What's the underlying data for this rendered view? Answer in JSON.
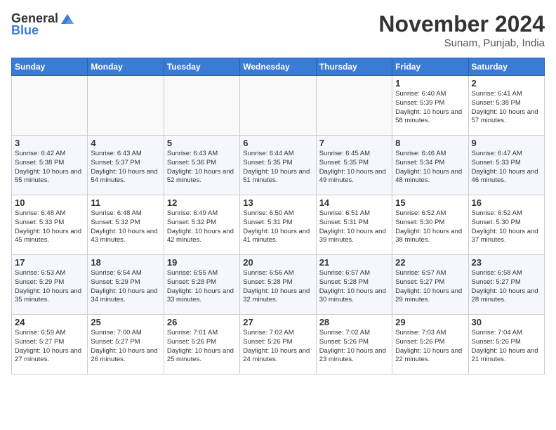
{
  "header": {
    "logo_general": "General",
    "logo_blue": "Blue",
    "month_title": "November 2024",
    "location": "Sunam, Punjab, India"
  },
  "weekdays": [
    "Sunday",
    "Monday",
    "Tuesday",
    "Wednesday",
    "Thursday",
    "Friday",
    "Saturday"
  ],
  "weeks": [
    [
      {
        "day": "",
        "empty": true
      },
      {
        "day": "",
        "empty": true
      },
      {
        "day": "",
        "empty": true
      },
      {
        "day": "",
        "empty": true
      },
      {
        "day": "",
        "empty": true
      },
      {
        "day": "1",
        "sunrise": "Sunrise: 6:40 AM",
        "sunset": "Sunset: 5:39 PM",
        "daylight": "Daylight: 10 hours and 58 minutes."
      },
      {
        "day": "2",
        "sunrise": "Sunrise: 6:41 AM",
        "sunset": "Sunset: 5:38 PM",
        "daylight": "Daylight: 10 hours and 57 minutes."
      }
    ],
    [
      {
        "day": "3",
        "sunrise": "Sunrise: 6:42 AM",
        "sunset": "Sunset: 5:38 PM",
        "daylight": "Daylight: 10 hours and 55 minutes."
      },
      {
        "day": "4",
        "sunrise": "Sunrise: 6:43 AM",
        "sunset": "Sunset: 5:37 PM",
        "daylight": "Daylight: 10 hours and 54 minutes."
      },
      {
        "day": "5",
        "sunrise": "Sunrise: 6:43 AM",
        "sunset": "Sunset: 5:36 PM",
        "daylight": "Daylight: 10 hours and 52 minutes."
      },
      {
        "day": "6",
        "sunrise": "Sunrise: 6:44 AM",
        "sunset": "Sunset: 5:35 PM",
        "daylight": "Daylight: 10 hours and 51 minutes."
      },
      {
        "day": "7",
        "sunrise": "Sunrise: 6:45 AM",
        "sunset": "Sunset: 5:35 PM",
        "daylight": "Daylight: 10 hours and 49 minutes."
      },
      {
        "day": "8",
        "sunrise": "Sunrise: 6:46 AM",
        "sunset": "Sunset: 5:34 PM",
        "daylight": "Daylight: 10 hours and 48 minutes."
      },
      {
        "day": "9",
        "sunrise": "Sunrise: 6:47 AM",
        "sunset": "Sunset: 5:33 PM",
        "daylight": "Daylight: 10 hours and 46 minutes."
      }
    ],
    [
      {
        "day": "10",
        "sunrise": "Sunrise: 6:48 AM",
        "sunset": "Sunset: 5:33 PM",
        "daylight": "Daylight: 10 hours and 45 minutes."
      },
      {
        "day": "11",
        "sunrise": "Sunrise: 6:48 AM",
        "sunset": "Sunset: 5:32 PM",
        "daylight": "Daylight: 10 hours and 43 minutes."
      },
      {
        "day": "12",
        "sunrise": "Sunrise: 6:49 AM",
        "sunset": "Sunset: 5:32 PM",
        "daylight": "Daylight: 10 hours and 42 minutes."
      },
      {
        "day": "13",
        "sunrise": "Sunrise: 6:50 AM",
        "sunset": "Sunset: 5:31 PM",
        "daylight": "Daylight: 10 hours and 41 minutes."
      },
      {
        "day": "14",
        "sunrise": "Sunrise: 6:51 AM",
        "sunset": "Sunset: 5:31 PM",
        "daylight": "Daylight: 10 hours and 39 minutes."
      },
      {
        "day": "15",
        "sunrise": "Sunrise: 6:52 AM",
        "sunset": "Sunset: 5:30 PM",
        "daylight": "Daylight: 10 hours and 38 minutes."
      },
      {
        "day": "16",
        "sunrise": "Sunrise: 6:52 AM",
        "sunset": "Sunset: 5:30 PM",
        "daylight": "Daylight: 10 hours and 37 minutes."
      }
    ],
    [
      {
        "day": "17",
        "sunrise": "Sunrise: 6:53 AM",
        "sunset": "Sunset: 5:29 PM",
        "daylight": "Daylight: 10 hours and 35 minutes."
      },
      {
        "day": "18",
        "sunrise": "Sunrise: 6:54 AM",
        "sunset": "Sunset: 5:29 PM",
        "daylight": "Daylight: 10 hours and 34 minutes."
      },
      {
        "day": "19",
        "sunrise": "Sunrise: 6:55 AM",
        "sunset": "Sunset: 5:28 PM",
        "daylight": "Daylight: 10 hours and 33 minutes."
      },
      {
        "day": "20",
        "sunrise": "Sunrise: 6:56 AM",
        "sunset": "Sunset: 5:28 PM",
        "daylight": "Daylight: 10 hours and 32 minutes."
      },
      {
        "day": "21",
        "sunrise": "Sunrise: 6:57 AM",
        "sunset": "Sunset: 5:28 PM",
        "daylight": "Daylight: 10 hours and 30 minutes."
      },
      {
        "day": "22",
        "sunrise": "Sunrise: 6:57 AM",
        "sunset": "Sunset: 5:27 PM",
        "daylight": "Daylight: 10 hours and 29 minutes."
      },
      {
        "day": "23",
        "sunrise": "Sunrise: 6:58 AM",
        "sunset": "Sunset: 5:27 PM",
        "daylight": "Daylight: 10 hours and 28 minutes."
      }
    ],
    [
      {
        "day": "24",
        "sunrise": "Sunrise: 6:59 AM",
        "sunset": "Sunset: 5:27 PM",
        "daylight": "Daylight: 10 hours and 27 minutes."
      },
      {
        "day": "25",
        "sunrise": "Sunrise: 7:00 AM",
        "sunset": "Sunset: 5:27 PM",
        "daylight": "Daylight: 10 hours and 26 minutes."
      },
      {
        "day": "26",
        "sunrise": "Sunrise: 7:01 AM",
        "sunset": "Sunset: 5:26 PM",
        "daylight": "Daylight: 10 hours and 25 minutes."
      },
      {
        "day": "27",
        "sunrise": "Sunrise: 7:02 AM",
        "sunset": "Sunset: 5:26 PM",
        "daylight": "Daylight: 10 hours and 24 minutes."
      },
      {
        "day": "28",
        "sunrise": "Sunrise: 7:02 AM",
        "sunset": "Sunset: 5:26 PM",
        "daylight": "Daylight: 10 hours and 23 minutes."
      },
      {
        "day": "29",
        "sunrise": "Sunrise: 7:03 AM",
        "sunset": "Sunset: 5:26 PM",
        "daylight": "Daylight: 10 hours and 22 minutes."
      },
      {
        "day": "30",
        "sunrise": "Sunrise: 7:04 AM",
        "sunset": "Sunset: 5:26 PM",
        "daylight": "Daylight: 10 hours and 21 minutes."
      }
    ]
  ]
}
